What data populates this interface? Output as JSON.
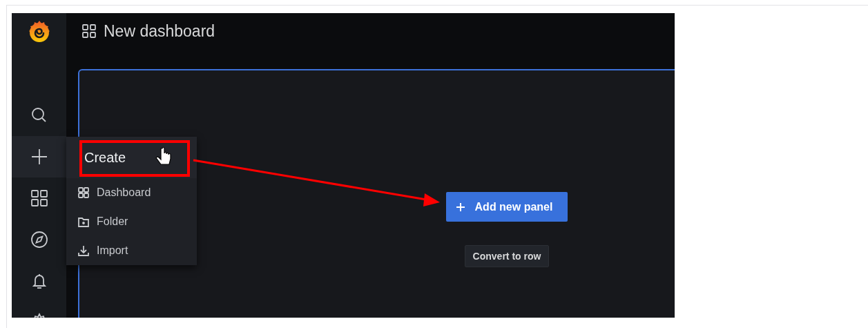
{
  "header": {
    "title": "New dashboard"
  },
  "sidebar": {
    "items": [
      {
        "kind": "search",
        "selected": false
      },
      {
        "kind": "create",
        "selected": true
      },
      {
        "kind": "dashboards",
        "selected": false
      },
      {
        "kind": "explore",
        "selected": false
      },
      {
        "kind": "alerting",
        "selected": false
      },
      {
        "kind": "settings",
        "selected": false
      }
    ]
  },
  "create_menu": {
    "title": "Create",
    "items": [
      {
        "kind": "dashboard",
        "label": "Dashboard"
      },
      {
        "kind": "folder",
        "label": "Folder"
      },
      {
        "kind": "import",
        "label": "Import"
      }
    ]
  },
  "panel": {
    "primary_button": "Add new panel",
    "secondary_button": "Convert to row"
  }
}
